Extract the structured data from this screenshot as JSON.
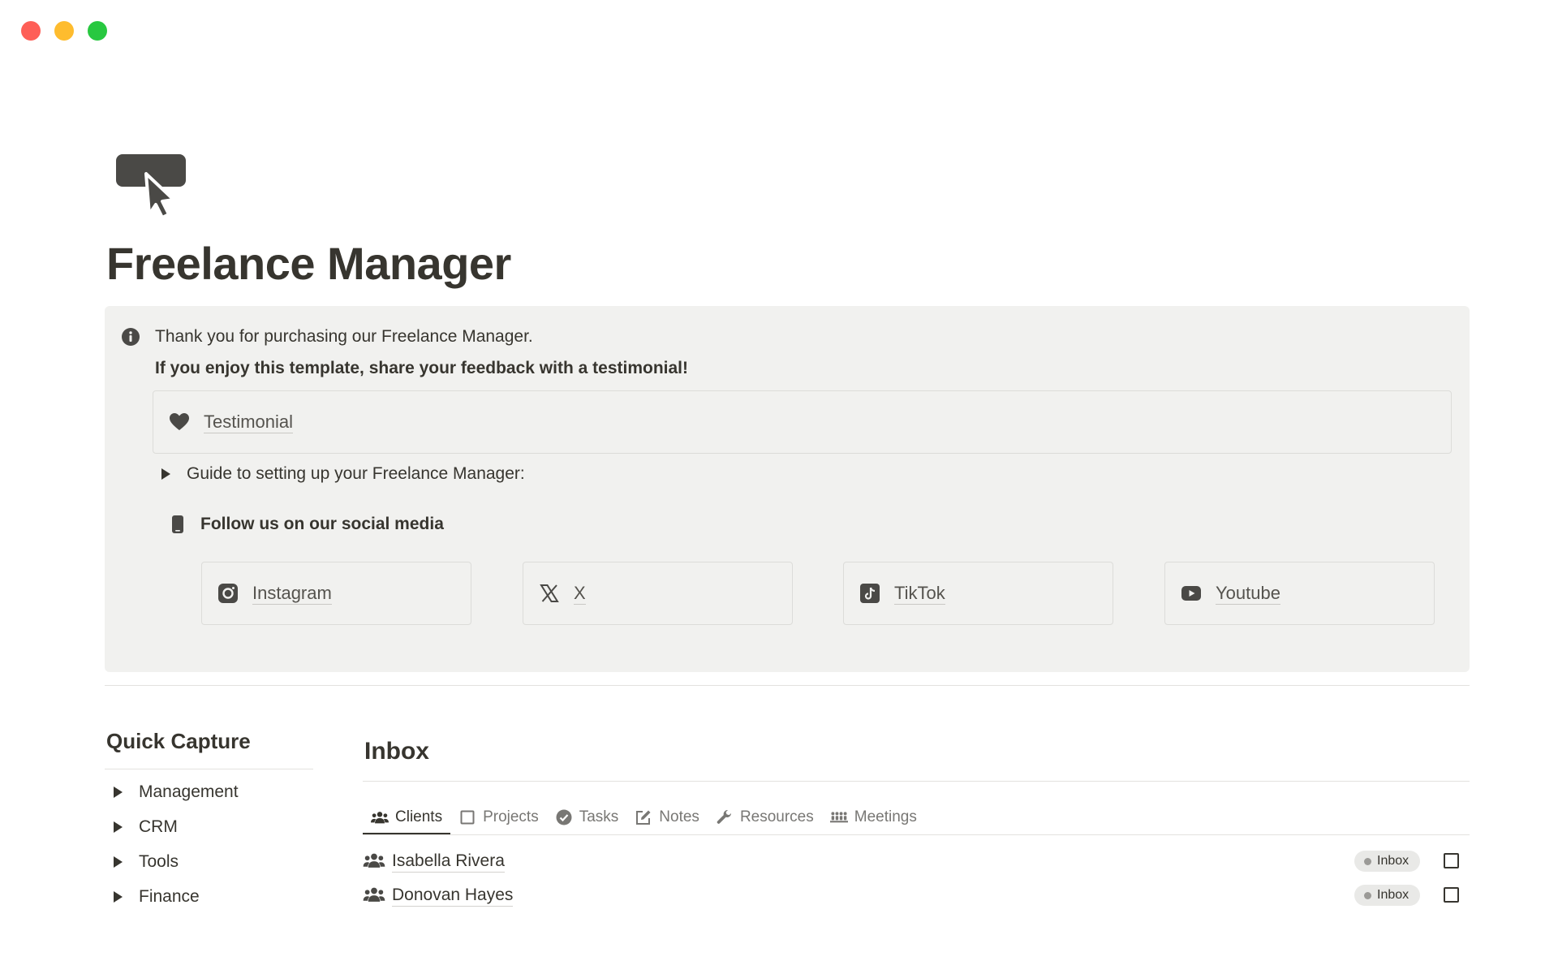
{
  "page": {
    "title": "Freelance Manager",
    "icon": "cursor-click-icon"
  },
  "callout": {
    "icon": "info-icon",
    "line1": "Thank you for purchasing our Freelance Manager.",
    "line2": "If you enjoy this template, share your feedback with a testimonial!",
    "testimonial": {
      "icon": "heart-icon",
      "label": "Testimonial"
    },
    "guide_toggle": "Guide to setting up your Freelance Manager:",
    "follow": {
      "icon": "phone-icon",
      "label": "Follow us on our social media"
    },
    "socials": [
      {
        "icon": "instagram-icon",
        "label": "Instagram"
      },
      {
        "icon": "x-icon",
        "label": "X"
      },
      {
        "icon": "tiktok-icon",
        "label": "TikTok"
      },
      {
        "icon": "youtube-icon",
        "label": "Youtube"
      }
    ]
  },
  "quick_capture": {
    "title": "Quick Capture",
    "items": [
      "Management",
      "CRM",
      "Tools",
      "Finance"
    ]
  },
  "inbox": {
    "title": "Inbox",
    "tabs": [
      {
        "icon": "people-icon",
        "label": "Clients",
        "active": true
      },
      {
        "icon": "square-icon",
        "label": "Projects"
      },
      {
        "icon": "check-circle-icon",
        "label": "Tasks"
      },
      {
        "icon": "edit-icon",
        "label": "Notes"
      },
      {
        "icon": "wrench-icon",
        "label": "Resources"
      },
      {
        "icon": "meeting-icon",
        "label": "Meetings"
      }
    ],
    "rows": [
      {
        "icon": "people-icon",
        "name": "Isabella Rivera",
        "status": "Inbox",
        "checked": false
      },
      {
        "icon": "people-icon",
        "name": "Donovan Hayes",
        "status": "Inbox",
        "checked": false
      }
    ]
  },
  "colors": {
    "text": "#37352f",
    "callout_bg": "#f1f1ef",
    "muted": "#787774",
    "badge_bg": "#e9e9e7"
  }
}
